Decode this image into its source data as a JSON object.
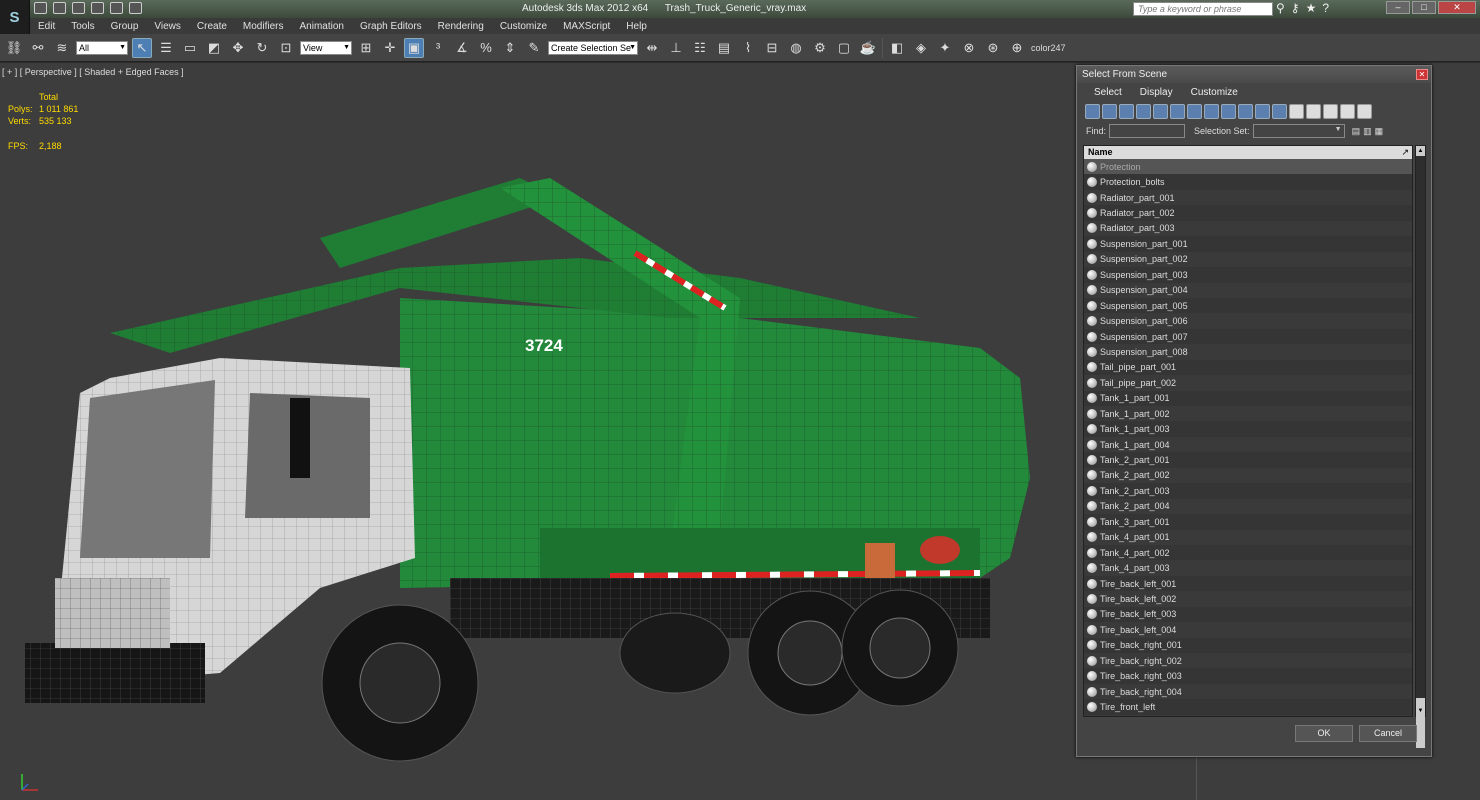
{
  "titlebar": {
    "app_name": "Autodesk 3ds Max  2012 x64",
    "file_name": "Trash_Truck_Generic_vray.max",
    "search_placeholder": "Type a keyword or phrase"
  },
  "menu": [
    "Edit",
    "Tools",
    "Group",
    "Views",
    "Create",
    "Modifiers",
    "Animation",
    "Graph Editors",
    "Rendering",
    "Customize",
    "MAXScript",
    "Help"
  ],
  "toolbar": {
    "filter_value": "All",
    "ref_coord_value": "View",
    "selection_set_placeholder": "Create Selection Se",
    "color_label": "color247"
  },
  "viewport": {
    "label": "[ + ] [ Perspective ] [ Shaded + Edged Faces ]",
    "stats": {
      "header": "Total",
      "polys_label": "Polys:",
      "polys": "1 011 861",
      "verts_label": "Verts:",
      "verts": "535 133",
      "fps_label": "FPS:",
      "fps": "2,188"
    },
    "truck_number": "3724"
  },
  "dialog": {
    "title": "Select From Scene",
    "menu": [
      "Select",
      "Display",
      "Customize"
    ],
    "find_label": "Find:",
    "selection_set_label": "Selection Set:",
    "column_name": "Name",
    "items": [
      "Protection",
      "Protection_bolts",
      "Radiator_part_001",
      "Radiator_part_002",
      "Radiator_part_003",
      "Suspension_part_001",
      "Suspension_part_002",
      "Suspension_part_003",
      "Suspension_part_004",
      "Suspension_part_005",
      "Suspension_part_006",
      "Suspension_part_007",
      "Suspension_part_008",
      "Tail_pipe_part_001",
      "Tail_pipe_part_002",
      "Tank_1_part_001",
      "Tank_1_part_002",
      "Tank_1_part_003",
      "Tank_1_part_004",
      "Tank_2_part_001",
      "Tank_2_part_002",
      "Tank_2_part_003",
      "Tank_2_part_004",
      "Tank_3_part_001",
      "Tank_4_part_001",
      "Tank_4_part_002",
      "Tank_4_part_003",
      "Tire_back_left_001",
      "Tire_back_left_002",
      "Tire_back_left_003",
      "Tire_back_left_004",
      "Tire_back_right_001",
      "Tire_back_right_002",
      "Tire_back_right_003",
      "Tire_back_right_004",
      "Tire_front_left"
    ],
    "ok_label": "OK",
    "cancel_label": "Cancel"
  }
}
